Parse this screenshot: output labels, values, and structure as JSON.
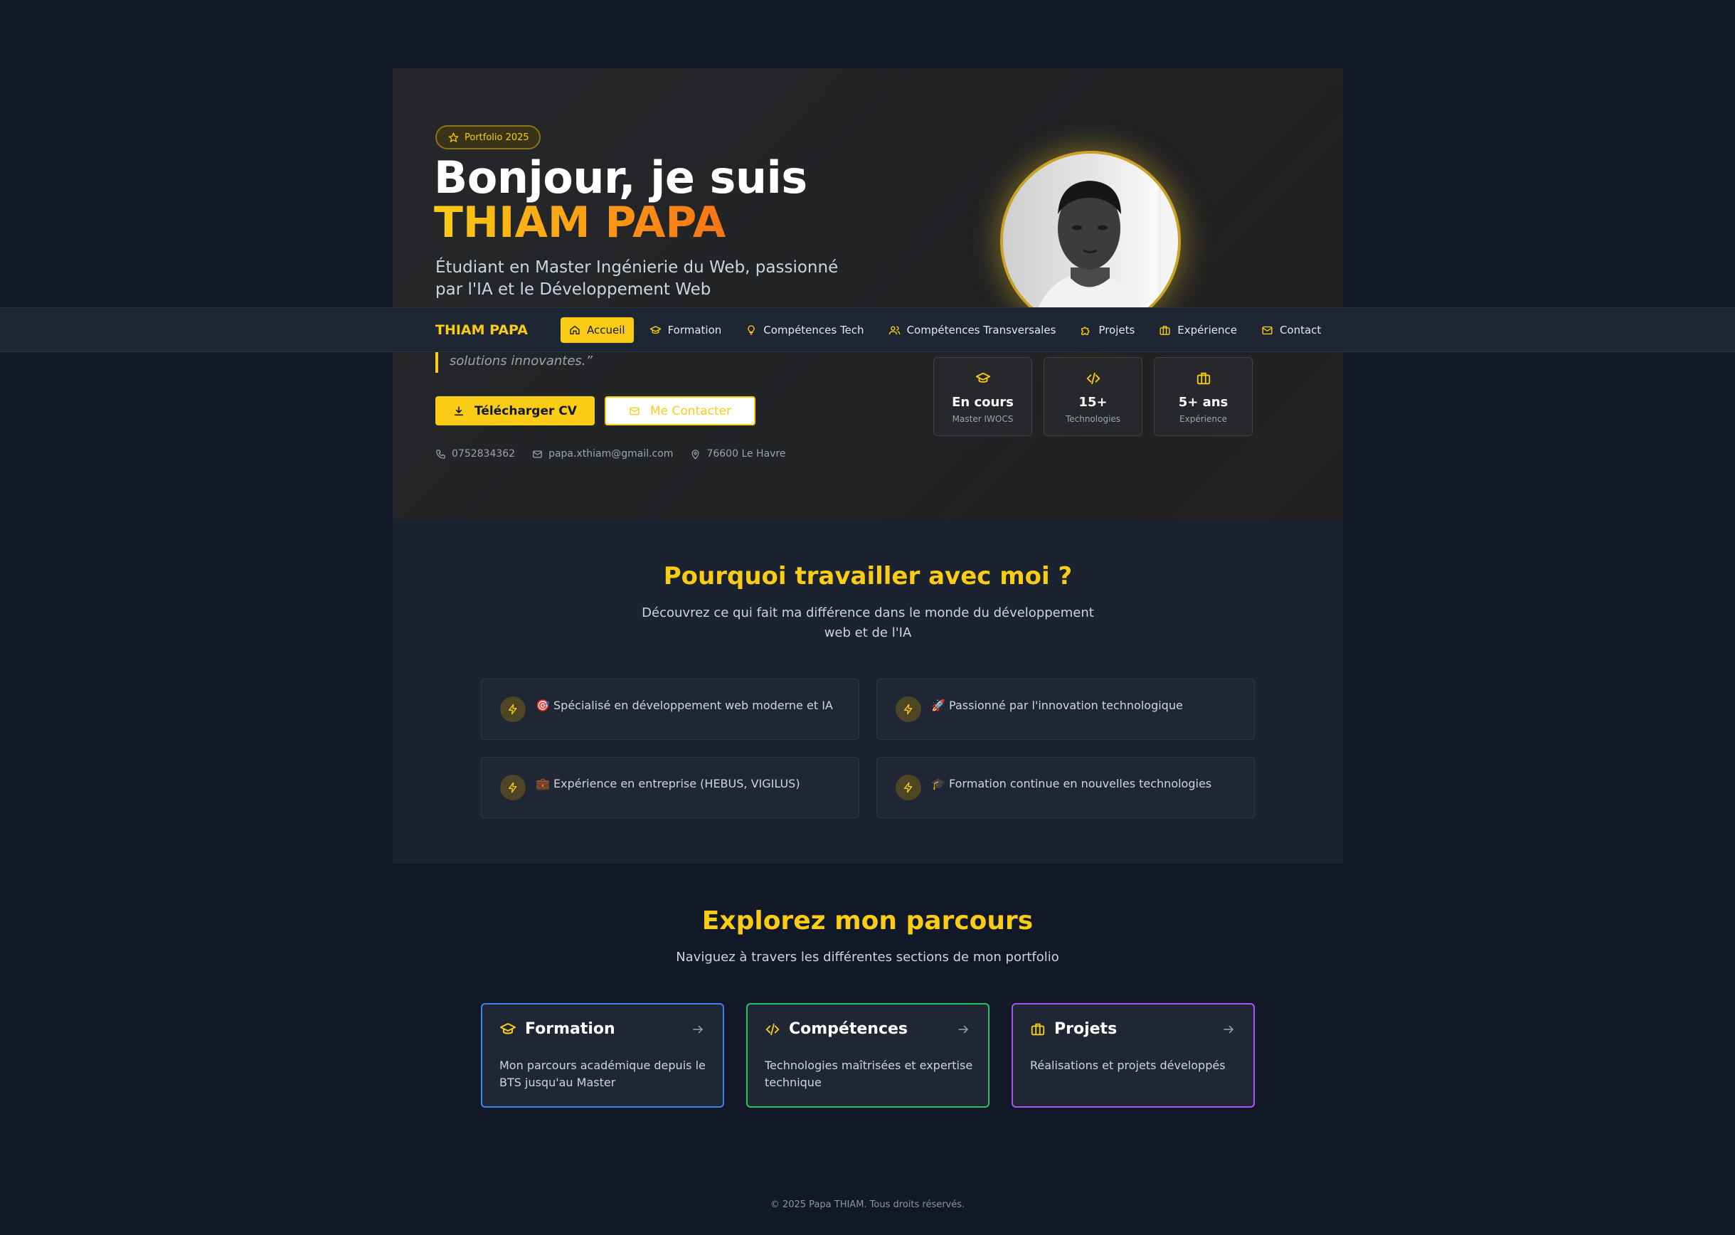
{
  "hero": {
    "badge": "Portfolio 2025",
    "greeting": "Bonjour, je suis",
    "name": "THIAM PAPA",
    "subtitle": "Étudiant en Master Ingénierie du Web, passionné par l'IA et le Développement Web",
    "quote": "solutions innovantes.”",
    "cv_button": "Télécharger CV",
    "contact_button": "Me Contacter",
    "phone": "0752834362",
    "email": "papa.xthiam@gmail.com",
    "location": "76600 Le Havre",
    "stats": [
      {
        "value": "En cours",
        "label": "Master IWOCS",
        "icon": "graduation-cap-icon"
      },
      {
        "value": "15+",
        "label": "Technologies",
        "icon": "code-icon"
      },
      {
        "value": "5+ ans",
        "label": "Expérience",
        "icon": "briefcase-icon"
      }
    ]
  },
  "nav": {
    "brand": "THIAM PAPA",
    "items": [
      {
        "label": "Accueil",
        "icon": "home-icon",
        "active": true
      },
      {
        "label": "Formation",
        "icon": "graduation-cap-icon"
      },
      {
        "label": "Compétences Tech",
        "icon": "lightbulb-icon"
      },
      {
        "label": "Compétences Transversales",
        "icon": "users-icon"
      },
      {
        "label": "Projets",
        "icon": "puzzle-icon"
      },
      {
        "label": "Expérience",
        "icon": "briefcase-icon"
      },
      {
        "label": "Contact",
        "icon": "mail-icon"
      }
    ]
  },
  "why": {
    "title": "Pourquoi travailler avec moi ?",
    "description": "Découvrez ce qui fait ma différence dans le monde du développement web et de l'IA",
    "cards": [
      {
        "text": "🎯 Spécialisé en développement web moderne et IA"
      },
      {
        "text": "🚀 Passionné par l'innovation technologique"
      },
      {
        "text": "💼 Expérience en entreprise (HEBUS, VIGILUS)"
      },
      {
        "text": "🎓 Formation continue en nouvelles technologies"
      }
    ]
  },
  "explore": {
    "title": "Explorez mon parcours",
    "subtitle": "Naviguez à travers les différentes sections de mon portfolio",
    "cards": [
      {
        "title": "Formation",
        "body": "Mon parcours académique depuis le BTS jusqu'au Master",
        "border": "#3b82f6"
      },
      {
        "title": "Compétences",
        "body": "Technologies maîtrisées et expertise technique",
        "border": "#22c55e"
      },
      {
        "title": "Projets",
        "body": "Réalisations et projets développés",
        "border": "#a855f7"
      }
    ]
  },
  "footer": {
    "text": "© 2025 Papa THIAM. Tous droits réservés."
  },
  "colors": {
    "accent": "#facc15",
    "orange": "#f97316",
    "background": "#111827"
  }
}
